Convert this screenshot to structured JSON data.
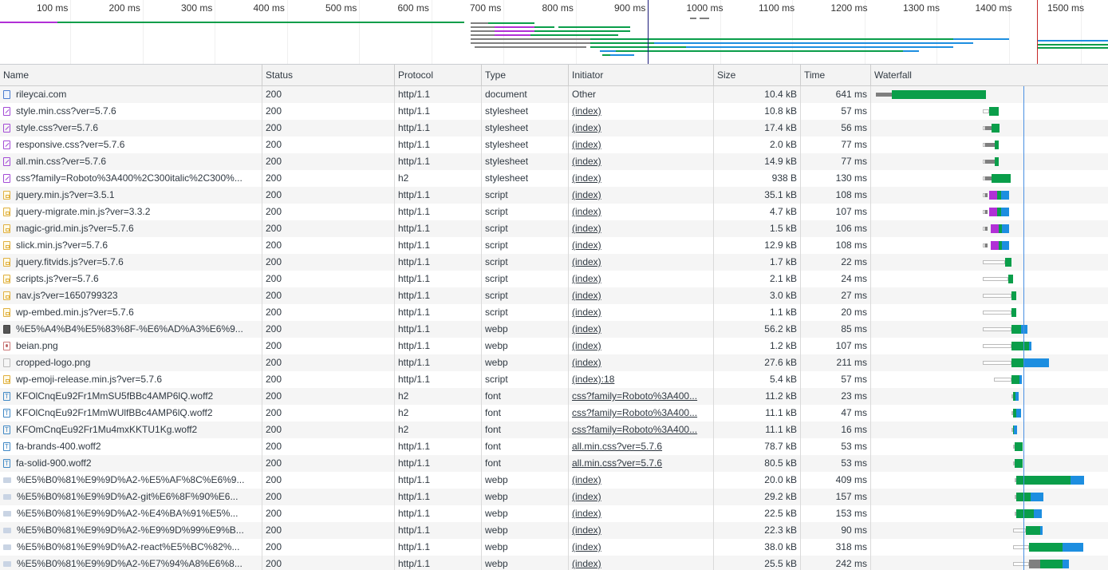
{
  "timeline": {
    "ticks": [
      "100 ms",
      "200 ms",
      "300 ms",
      "400 ms",
      "500 ms",
      "600 ms",
      "700 ms",
      "800 ms",
      "900 ms",
      "1000 ms",
      "1100 ms",
      "1200 ms",
      "1300 ms",
      "1400 ms",
      "1500 ms"
    ]
  },
  "columns": {
    "name": "Name",
    "status": "Status",
    "protocol": "Protocol",
    "type": "Type",
    "initiator": "Initiator",
    "size": "Size",
    "time": "Time",
    "waterfall": "Waterfall"
  },
  "colors": {
    "waiting": "#7f7f7f",
    "download": "#0a9e4a",
    "content": "#1d8ee0",
    "ssl": "#b130d6",
    "queued": "#ffffff",
    "domcontentloaded": "#1a1a7a",
    "load": "#c62828"
  },
  "rows": [
    {
      "icon": "document",
      "name": "rileycai.com",
      "status": "200",
      "protocol": "http/1.1",
      "type": "document",
      "initiator": "Other",
      "initiator_link": false,
      "size": "10.4 kB",
      "time": "641 ms"
    },
    {
      "icon": "stylesheet",
      "name": "style.min.css?ver=5.7.6",
      "status": "200",
      "protocol": "http/1.1",
      "type": "stylesheet",
      "initiator": "(index)",
      "initiator_link": true,
      "size": "10.8 kB",
      "time": "57 ms"
    },
    {
      "icon": "stylesheet",
      "name": "style.css?ver=5.7.6",
      "status": "200",
      "protocol": "http/1.1",
      "type": "stylesheet",
      "initiator": "(index)",
      "initiator_link": true,
      "size": "17.4 kB",
      "time": "56 ms"
    },
    {
      "icon": "stylesheet",
      "name": "responsive.css?ver=5.7.6",
      "status": "200",
      "protocol": "http/1.1",
      "type": "stylesheet",
      "initiator": "(index)",
      "initiator_link": true,
      "size": "2.0 kB",
      "time": "77 ms"
    },
    {
      "icon": "stylesheet",
      "name": "all.min.css?ver=5.7.6",
      "status": "200",
      "protocol": "http/1.1",
      "type": "stylesheet",
      "initiator": "(index)",
      "initiator_link": true,
      "size": "14.9 kB",
      "time": "77 ms"
    },
    {
      "icon": "stylesheet",
      "name": "css?family=Roboto%3A400%2C300italic%2C300%...",
      "status": "200",
      "protocol": "h2",
      "type": "stylesheet",
      "initiator": "(index)",
      "initiator_link": true,
      "size": "938 B",
      "time": "130 ms"
    },
    {
      "icon": "script",
      "name": "jquery.min.js?ver=3.5.1",
      "status": "200",
      "protocol": "http/1.1",
      "type": "script",
      "initiator": "(index)",
      "initiator_link": true,
      "size": "35.1 kB",
      "time": "108 ms"
    },
    {
      "icon": "script",
      "name": "jquery-migrate.min.js?ver=3.3.2",
      "status": "200",
      "protocol": "http/1.1",
      "type": "script",
      "initiator": "(index)",
      "initiator_link": true,
      "size": "4.7 kB",
      "time": "107 ms"
    },
    {
      "icon": "script",
      "name": "magic-grid.min.js?ver=5.7.6",
      "status": "200",
      "protocol": "http/1.1",
      "type": "script",
      "initiator": "(index)",
      "initiator_link": true,
      "size": "1.5 kB",
      "time": "106 ms"
    },
    {
      "icon": "script",
      "name": "slick.min.js?ver=5.7.6",
      "status": "200",
      "protocol": "http/1.1",
      "type": "script",
      "initiator": "(index)",
      "initiator_link": true,
      "size": "12.9 kB",
      "time": "108 ms"
    },
    {
      "icon": "script",
      "name": "jquery.fitvids.js?ver=5.7.6",
      "status": "200",
      "protocol": "http/1.1",
      "type": "script",
      "initiator": "(index)",
      "initiator_link": true,
      "size": "1.7 kB",
      "time": "22 ms"
    },
    {
      "icon": "script",
      "name": "scripts.js?ver=5.7.6",
      "status": "200",
      "protocol": "http/1.1",
      "type": "script",
      "initiator": "(index)",
      "initiator_link": true,
      "size": "2.1 kB",
      "time": "24 ms"
    },
    {
      "icon": "script",
      "name": "nav.js?ver=1650799323",
      "status": "200",
      "protocol": "http/1.1",
      "type": "script",
      "initiator": "(index)",
      "initiator_link": true,
      "size": "3.0 kB",
      "time": "27 ms"
    },
    {
      "icon": "script",
      "name": "wp-embed.min.js?ver=5.7.6",
      "status": "200",
      "protocol": "http/1.1",
      "type": "script",
      "initiator": "(index)",
      "initiator_link": true,
      "size": "1.1 kB",
      "time": "20 ms"
    },
    {
      "icon": "img-dark",
      "name": "%E5%A4%B4%E5%83%8F-%E6%AD%A3%E6%9...",
      "status": "200",
      "protocol": "http/1.1",
      "type": "webp",
      "initiator": "(index)",
      "initiator_link": true,
      "size": "56.2 kB",
      "time": "85 ms"
    },
    {
      "icon": "img-beian",
      "name": "beian.png",
      "status": "200",
      "protocol": "http/1.1",
      "type": "webp",
      "initiator": "(index)",
      "initiator_link": true,
      "size": "1.2 kB",
      "time": "107 ms"
    },
    {
      "icon": "img-light",
      "name": "cropped-logo.png",
      "status": "200",
      "protocol": "http/1.1",
      "type": "webp",
      "initiator": "(index)",
      "initiator_link": true,
      "size": "27.6 kB",
      "time": "211 ms"
    },
    {
      "icon": "script",
      "name": "wp-emoji-release.min.js?ver=5.7.6",
      "status": "200",
      "protocol": "http/1.1",
      "type": "script",
      "initiator": "(index):18",
      "initiator_link": true,
      "size": "5.4 kB",
      "time": "57 ms"
    },
    {
      "icon": "font",
      "name": "KFOlCnqEu92Fr1MmSU5fBBc4AMP6lQ.woff2",
      "status": "200",
      "protocol": "h2",
      "type": "font",
      "initiator": "css?family=Roboto%3A400...",
      "initiator_link": true,
      "size": "11.2 kB",
      "time": "23 ms"
    },
    {
      "icon": "font",
      "name": "KFOlCnqEu92Fr1MmWUlfBBc4AMP6lQ.woff2",
      "status": "200",
      "protocol": "h2",
      "type": "font",
      "initiator": "css?family=Roboto%3A400...",
      "initiator_link": true,
      "size": "11.1 kB",
      "time": "47 ms"
    },
    {
      "icon": "font",
      "name": "KFOmCnqEu92Fr1Mu4mxKKTU1Kg.woff2",
      "status": "200",
      "protocol": "h2",
      "type": "font",
      "initiator": "css?family=Roboto%3A400...",
      "initiator_link": true,
      "size": "11.1 kB",
      "time": "16 ms"
    },
    {
      "icon": "font",
      "name": "fa-brands-400.woff2",
      "status": "200",
      "protocol": "http/1.1",
      "type": "font",
      "initiator": "all.min.css?ver=5.7.6",
      "initiator_link": true,
      "size": "78.7 kB",
      "time": "53 ms"
    },
    {
      "icon": "font",
      "name": "fa-solid-900.woff2",
      "status": "200",
      "protocol": "http/1.1",
      "type": "font",
      "initiator": "all.min.css?ver=5.7.6",
      "initiator_link": true,
      "size": "80.5 kB",
      "time": "53 ms"
    },
    {
      "icon": "img-thumb",
      "name": "%E5%B0%81%E9%9D%A2-%E5%AF%8C%E6%9...",
      "status": "200",
      "protocol": "http/1.1",
      "type": "webp",
      "initiator": "(index)",
      "initiator_link": true,
      "size": "20.0 kB",
      "time": "409 ms"
    },
    {
      "icon": "img-thumb",
      "name": "%E5%B0%81%E9%9D%A2-git%E6%8F%90%E6...",
      "status": "200",
      "protocol": "http/1.1",
      "type": "webp",
      "initiator": "(index)",
      "initiator_link": true,
      "size": "29.2 kB",
      "time": "157 ms"
    },
    {
      "icon": "img-thumb",
      "name": "%E5%B0%81%E9%9D%A2-%E4%BA%91%E5%...",
      "status": "200",
      "protocol": "http/1.1",
      "type": "webp",
      "initiator": "(index)",
      "initiator_link": true,
      "size": "22.5 kB",
      "time": "153 ms"
    },
    {
      "icon": "img-thumb",
      "name": "%E5%B0%81%E9%9D%A2-%E9%9D%99%E9%B...",
      "status": "200",
      "protocol": "http/1.1",
      "type": "webp",
      "initiator": "(index)",
      "initiator_link": true,
      "size": "22.3 kB",
      "time": "90 ms"
    },
    {
      "icon": "img-thumb",
      "name": "%E5%B0%81%E9%9D%A2-react%E5%BC%82%...",
      "status": "200",
      "protocol": "http/1.1",
      "type": "webp",
      "initiator": "(index)",
      "initiator_link": true,
      "size": "38.0 kB",
      "time": "318 ms"
    },
    {
      "icon": "img-thumb",
      "name": "%E5%B0%81%E9%9D%A2-%E7%94%A8%E6%8...",
      "status": "200",
      "protocol": "http/1.1",
      "type": "webp",
      "initiator": "(index)",
      "initiator_link": true,
      "size": "25.5 kB",
      "time": "242 ms"
    }
  ]
}
